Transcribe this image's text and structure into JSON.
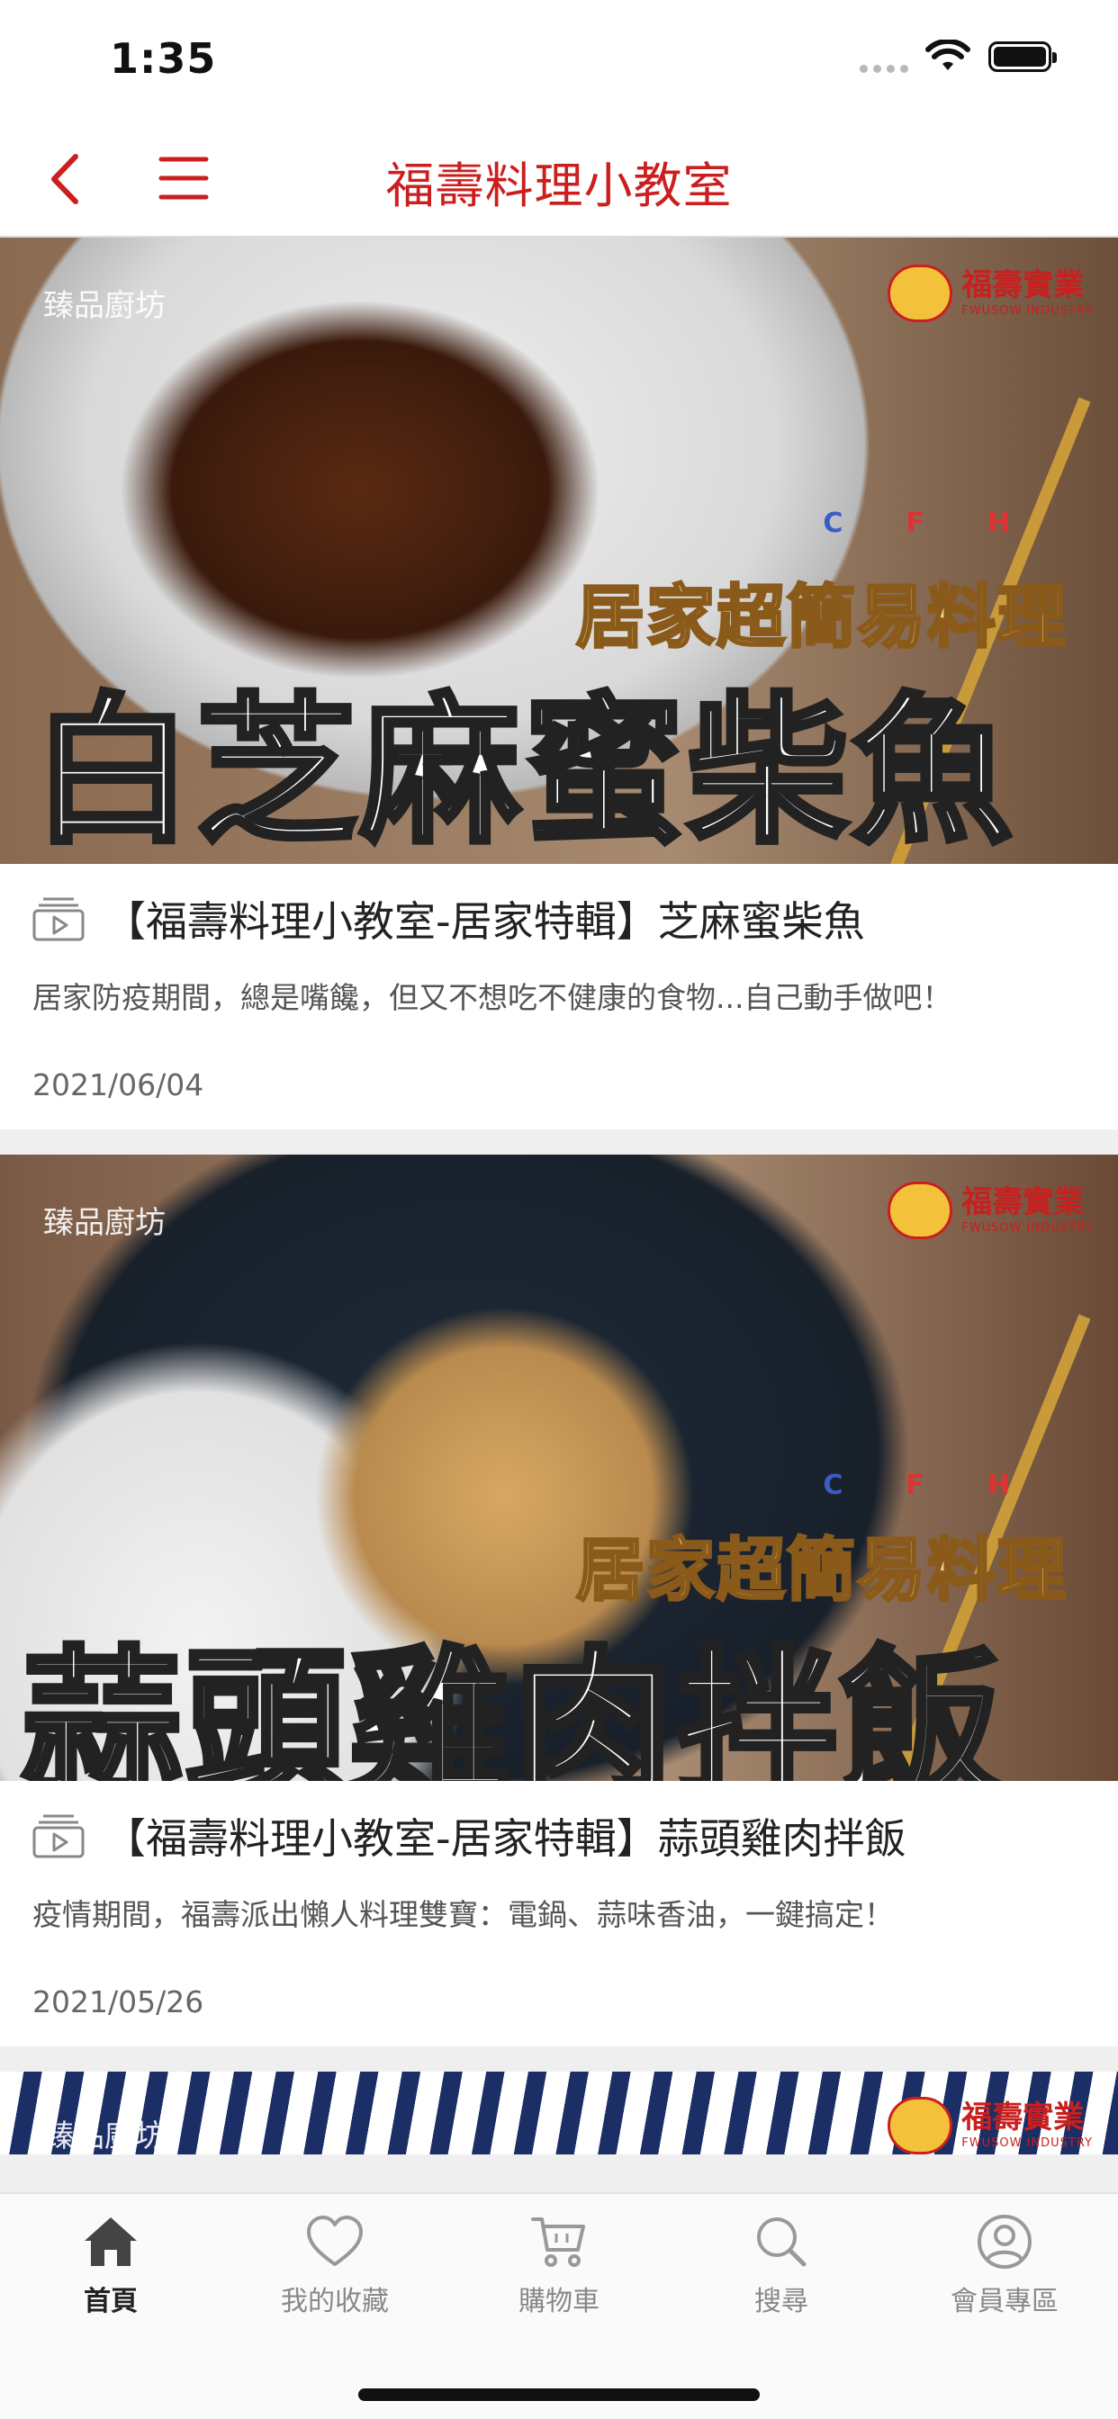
{
  "status_bar": {
    "time": "1:35"
  },
  "nav": {
    "title": "福壽料理小教室"
  },
  "posts": [
    {
      "thumbnail": {
        "watermark_left": "臻品廚坊",
        "brand_zh": "福壽實業",
        "brand_en": "FWUSOW INDUSTRY",
        "cfh": [
          "C",
          "F",
          "H"
        ],
        "subtitle": "居家超簡易料理",
        "headline": "白芝麻蜜柴魚"
      },
      "title": "【福壽料理小教室-居家特輯】芝麻蜜柴魚",
      "description": "居家防疫期間，總是嘴饞，但又不想吃不健康的食物...自己動手做吧！",
      "date": "2021/06/04"
    },
    {
      "thumbnail": {
        "watermark_left": "臻品廚坊",
        "brand_zh": "福壽實業",
        "brand_en": "FWUSOW INDUSTRY",
        "cfh": [
          "C",
          "F",
          "H"
        ],
        "subtitle": "居家超簡易料理",
        "headline": "蒜頭雞肉拌飯"
      },
      "title": "【福壽料理小教室-居家特輯】蒜頭雞肉拌飯",
      "description": "疫情期間，福壽派出懶人料理雙寶：電鍋、蒜味香油，一鍵搞定！",
      "date": "2021/05/26"
    },
    {
      "thumbnail": {
        "watermark_left": "臻品廚坊",
        "brand_zh": "福壽實業",
        "brand_en": "FWUSOW INDUSTRY"
      }
    }
  ],
  "tabs": [
    {
      "label": "首頁",
      "icon": "home-icon",
      "active": true
    },
    {
      "label": "我的收藏",
      "icon": "heart-icon",
      "active": false
    },
    {
      "label": "購物車",
      "icon": "cart-icon",
      "active": false
    },
    {
      "label": "搜尋",
      "icon": "search-icon",
      "active": false
    },
    {
      "label": "會員專區",
      "icon": "user-icon",
      "active": false
    }
  ],
  "colors": {
    "accent": "#cc1e1e",
    "tab_active": "#222222",
    "tab_inactive": "#888888"
  }
}
